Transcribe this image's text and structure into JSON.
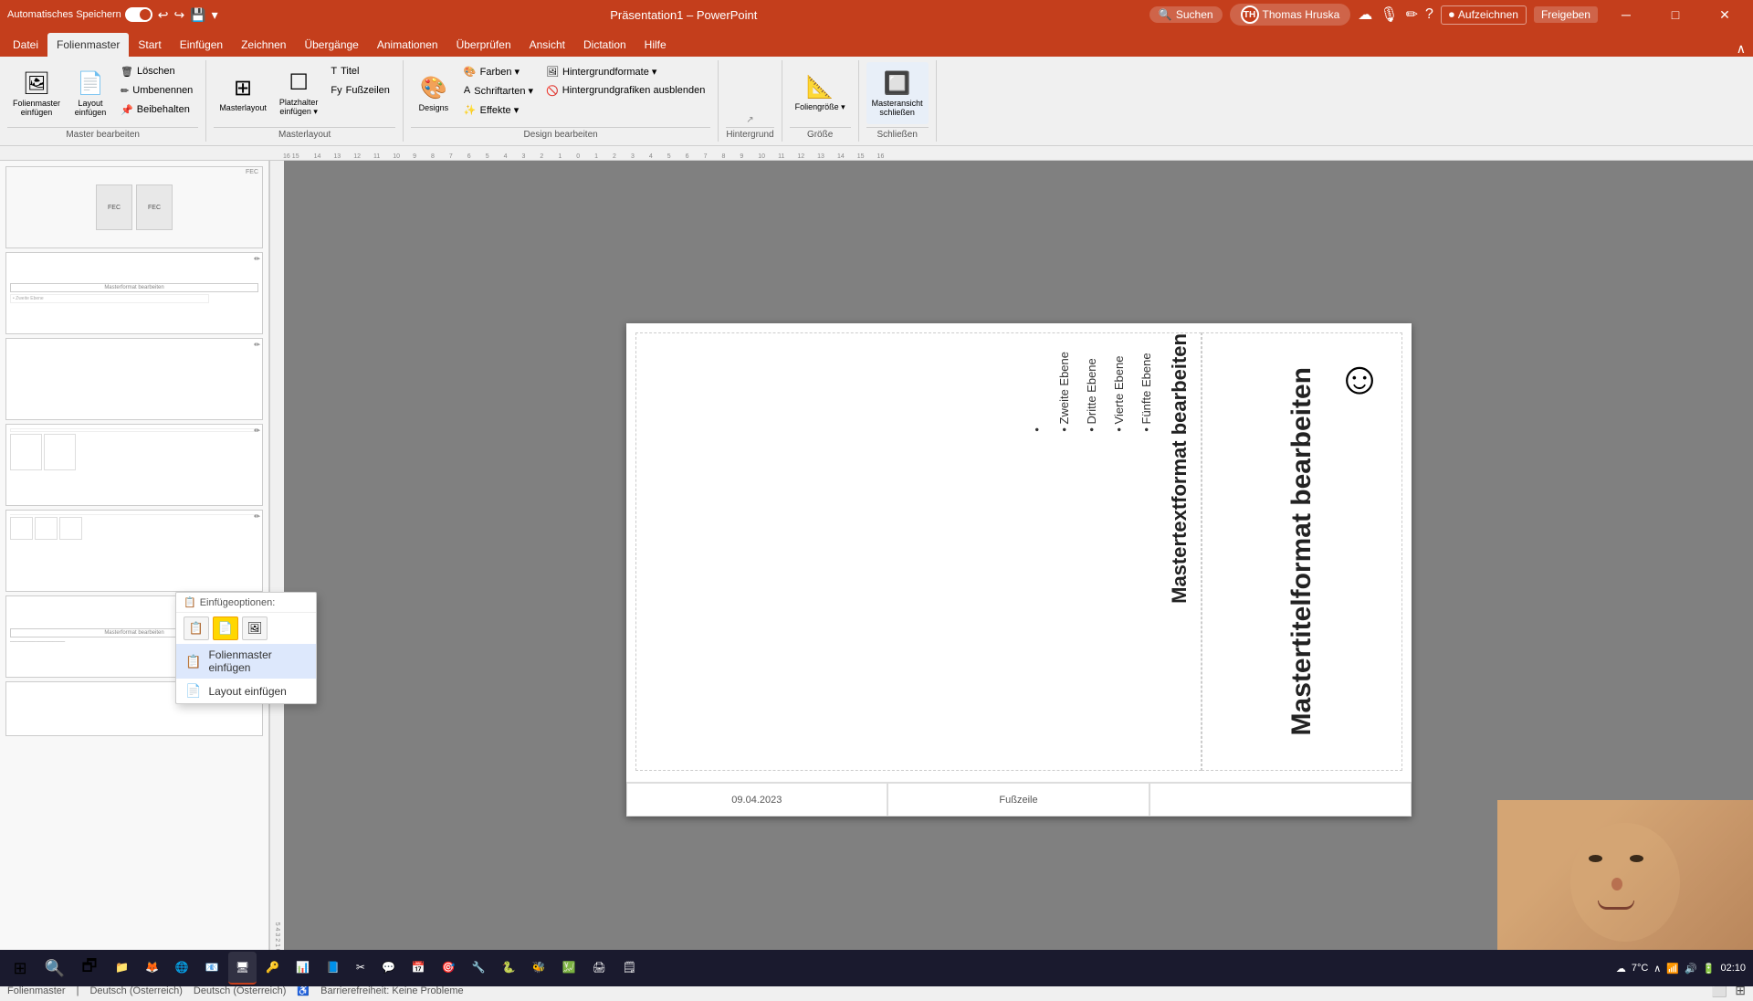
{
  "titlebar": {
    "autosave_label": "Automatisches Speichern",
    "filename": "Präsentation1",
    "app": "PowerPoint",
    "user": "Thomas Hruska",
    "search_placeholder": "Suchen",
    "record_btn": "Aufzeichnen",
    "share_btn": "Freigeben",
    "minimize": "─",
    "maximize": "□",
    "close": "✕"
  },
  "ribbon_tabs": {
    "tabs": [
      "Datei",
      "Folienmaster",
      "Start",
      "Einfügen",
      "Zeichnen",
      "Übergänge",
      "Animationen",
      "Überprüfen",
      "Ansicht",
      "Dictation",
      "Hilfe"
    ],
    "active": "Folienmaster"
  },
  "ribbon": {
    "groups": [
      {
        "label": "Master bearbeiten",
        "buttons": [
          {
            "label": "Folienmaster\neinfügen",
            "icon": "🖼"
          },
          {
            "label": "Layout\neinfügen",
            "icon": "📄"
          },
          {
            "label": "Löschen",
            "icon": "🗑"
          },
          {
            "label": "Umbenennen",
            "icon": "✏"
          },
          {
            "label": "Beibehalten",
            "icon": "📌"
          }
        ]
      },
      {
        "label": "Masterlayout",
        "buttons": [
          {
            "label": "Masterlayout",
            "icon": "⊞"
          },
          {
            "label": "Platzhalter\neinfügen ▾",
            "icon": "☐"
          },
          {
            "label": "Titel",
            "icon": "T"
          },
          {
            "label": "Fußzeilen",
            "icon": "Fy"
          }
        ]
      },
      {
        "label": "Design bearbeiten",
        "buttons": [
          {
            "label": "Designs",
            "icon": "🎨"
          },
          {
            "label": "Farben ▾",
            "icon": "🎨"
          },
          {
            "label": "Schriftarten ▾",
            "icon": "A"
          },
          {
            "label": "Effekte ▾",
            "icon": "✨"
          },
          {
            "label": "Hintergrundformate ▾",
            "icon": "🖼"
          },
          {
            "label": "Hintergrundgrafiken ausblenden",
            "icon": "🚫"
          }
        ]
      },
      {
        "label": "Hintergrund",
        "buttons": []
      },
      {
        "label": "Größe",
        "buttons": [
          {
            "label": "Foliengröße ▾",
            "icon": "📐"
          }
        ]
      },
      {
        "label": "Schließen",
        "buttons": [
          {
            "label": "Masteransicht\nschließen",
            "icon": "✕"
          }
        ]
      }
    ]
  },
  "slide_panel": {
    "slides": [
      {
        "id": 1,
        "label": ""
      },
      {
        "id": 2,
        "label": "Masterformat bearbeiten"
      },
      {
        "id": 3,
        "label": ""
      },
      {
        "id": 4,
        "label": ""
      },
      {
        "id": 5,
        "label": ""
      },
      {
        "id": 6,
        "label": "Masterformat bearbeiten"
      },
      {
        "id": 7,
        "label": ""
      }
    ]
  },
  "slide": {
    "title": "Mastertitelformat bearbeiten",
    "content_title": "Mastertextformat bearbeiten",
    "bullet_levels": [
      "Zweite Ebene",
      "Dritte Ebene",
      "Vierte Ebene",
      "Fünfte Ebene"
    ],
    "smiley": "☺",
    "date": "09.04.2023",
    "footer": "Fußzeile"
  },
  "context_menu": {
    "header": "Einfügeoptionen:",
    "items": [
      {
        "label": "Folienmaster einfügen",
        "icon": "🖼"
      },
      {
        "label": "Layout einfügen",
        "icon": "📄"
      }
    ]
  },
  "status_bar": {
    "view": "Folienmaster",
    "language": "Deutsch (Österreich)",
    "accessibility": "Barrierefreiheit: Keine Probleme"
  },
  "taskbar": {
    "apps": [
      "⊞",
      "📁",
      "🦊",
      "🌐",
      "📧",
      "🖥",
      "🔑",
      "📊",
      "📘",
      "✂",
      "💬",
      "📅",
      "🎯",
      "🔧",
      "🐍",
      "🐝",
      "🌐",
      "💹",
      "🖨",
      "🗒"
    ]
  }
}
